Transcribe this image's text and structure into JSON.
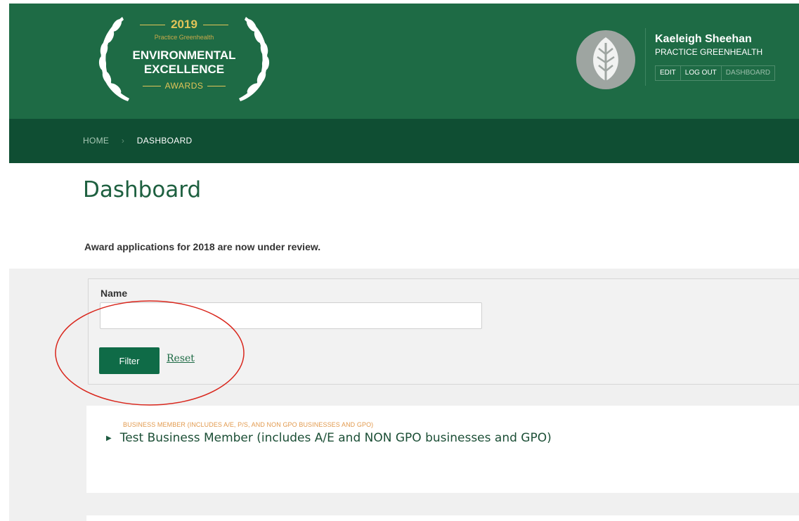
{
  "logo": {
    "year": "2019",
    "org": "Practice Greenhealth",
    "title_line1": "ENVIRONMENTAL",
    "title_line2": "EXCELLENCE",
    "awards": "AWARDS"
  },
  "user": {
    "name": "Kaeleigh Sheehan",
    "organization": "PRACTICE GREENHEALTH",
    "links": [
      "EDIT",
      "LOG OUT",
      "DASHBOARD"
    ]
  },
  "breadcrumb": {
    "home": "HOME",
    "separator": "›",
    "current": "DASHBOARD"
  },
  "page": {
    "title": "Dashboard",
    "notice": "Award applications for 2018 are now under review."
  },
  "filter": {
    "name_label": "Name",
    "name_value": "",
    "filter_button": "Filter",
    "reset_link": "Reset"
  },
  "results": [
    {
      "category": "BUSINESS MEMBER (INCLUDES A/E, P/S, AND NON GPO BUSINESSES AND GPO)",
      "title": "Test Business Member (includes A/E and NON GPO businesses and GPO)",
      "caret_icon": "caret-right-icon"
    }
  ],
  "colors": {
    "header_green": "#1e6b45",
    "breadcrumb_green": "#0f4e33",
    "button_green": "#0f6b47",
    "gold": "#e1c458",
    "category_orange": "#e29a4e",
    "highlight_red": "#d9261c"
  }
}
